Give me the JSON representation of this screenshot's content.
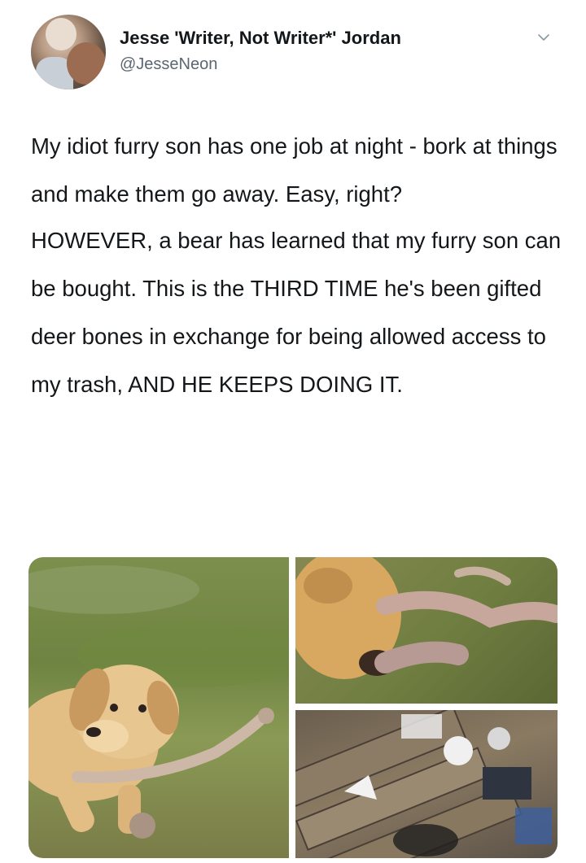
{
  "author": {
    "display_name": "Jesse 'Writer, Not Writer*' Jordan",
    "handle": "@JesseNeon",
    "avatar_icon": "avatar-photo"
  },
  "menu": {
    "icon": "chevron-down-icon"
  },
  "tweet": {
    "paragraph_1": "My idiot furry son has one job at night - bork at things and make them go away. Easy, right?",
    "paragraph_2": "HOWEVER, a bear has learned that my furry son can be bought. This is the THIRD TIME he's been gifted deer bones in exchange for being allowed access to my trash, AND HE KEEPS DOING IT."
  },
  "media": {
    "photos": [
      {
        "description_icon": "dog-with-bone-photo"
      },
      {
        "description_icon": "dog-closeup-bone-photo"
      },
      {
        "description_icon": "scattered-trash-photo"
      }
    ]
  },
  "colors": {
    "text": "#14171a",
    "secondary_text": "#5b6670",
    "background": "#ffffff"
  }
}
